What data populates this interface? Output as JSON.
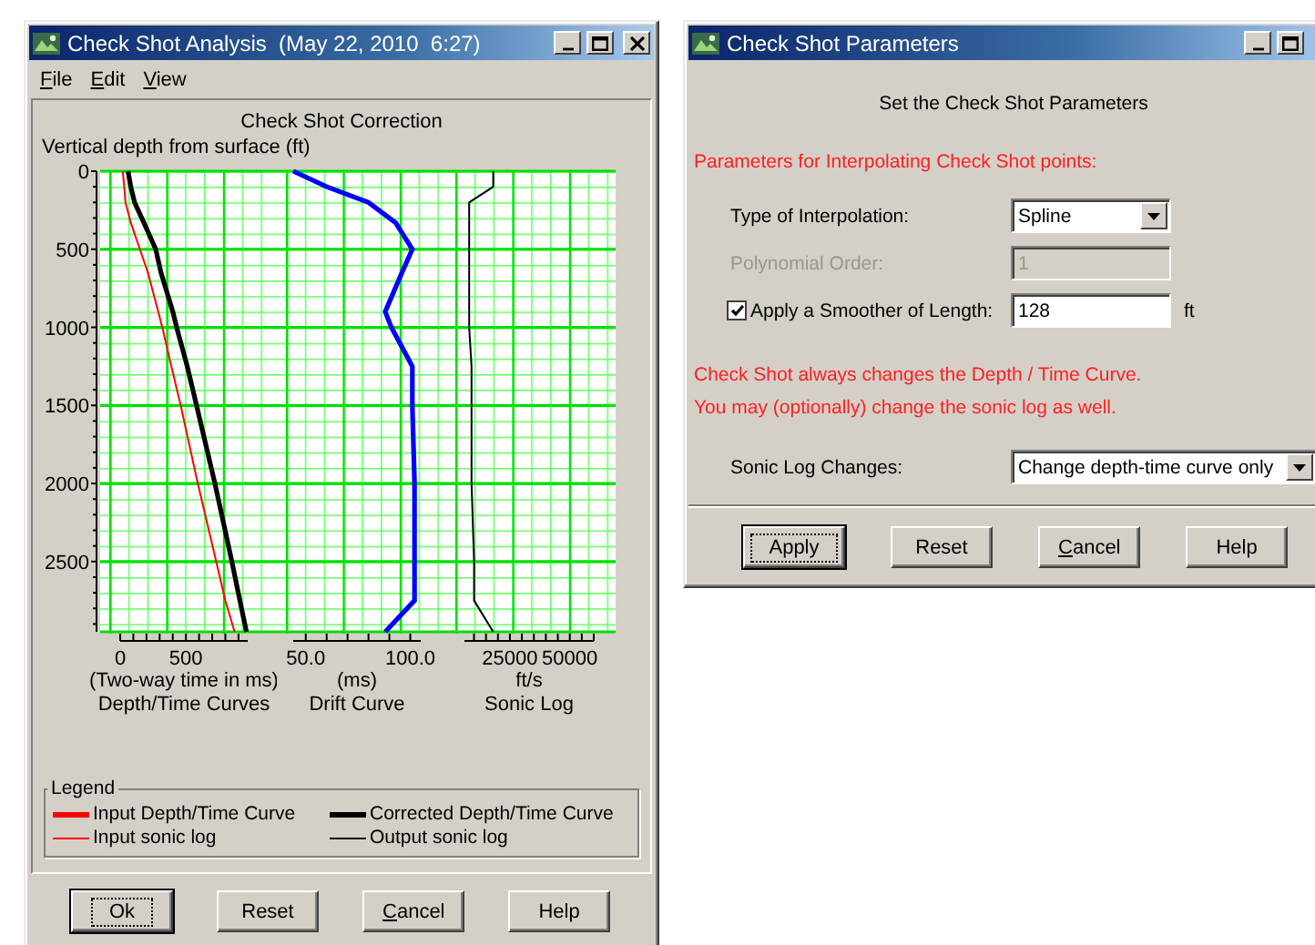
{
  "analysis_window": {
    "title": "Check Shot Analysis  (May 22, 2010  6:27)",
    "menu": [
      {
        "label": "File"
      },
      {
        "label": "Edit"
      },
      {
        "label": "View"
      }
    ],
    "chart_title": "Check Shot Correction",
    "charts": [
      {
        "chart_data": {
          "type": "line",
          "orientation": "horizontal",
          "title": "Depth/Time Curves",
          "xlabel": "(Two-way time in ms)",
          "ylabel": "Vertical depth from surface (ft)",
          "x": [
            0,
            100,
            200,
            330,
            500,
            650,
            900,
            1000,
            1250,
            1500,
            2000,
            2500,
            2750,
            2950
          ],
          "xlim": [
            0,
            970
          ],
          "ylim": [
            2950,
            0
          ],
          "grid": true,
          "xticks": [
            0,
            500
          ],
          "yticks": [
            0,
            500,
            1000,
            1500,
            2000,
            2500
          ],
          "series": [
            {
              "color": "#ff0000",
              "values": [
                20,
                30,
                40,
                80,
                150,
                210,
                290,
                320,
                390,
                460,
                590,
                730,
                800,
                870
              ]
            },
            {
              "color": "#000000",
              "values": [
                60,
                80,
                110,
                180,
                270,
                310,
                400,
                430,
                510,
                580,
                720,
                850,
                910,
                960
              ]
            }
          ]
        }
      },
      {
        "chart_data": {
          "type": "line",
          "orientation": "horizontal",
          "title": "Drift Curve",
          "xlabel": "(ms)",
          "x": [
            0,
            100,
            200,
            330,
            500,
            650,
            900,
            1000,
            1250,
            1500,
            2000,
            2500,
            2750,
            2950
          ],
          "xlim": [
            44,
            105
          ],
          "ylim": [
            2950,
            0
          ],
          "grid": true,
          "xticks": [
            {
              "value": 50,
              "label": "50.0"
            },
            {
              "value": 100,
              "label": "100.0"
            }
          ],
          "series": [
            {
              "color": "#0000ff",
              "values": [
                44,
                60,
                80,
                93,
                101,
                96,
                88,
                91,
                101,
                101,
                102,
                102,
                102,
                88
              ]
            }
          ]
        }
      },
      {
        "chart_data": {
          "type": "line",
          "orientation": "horizontal",
          "title": "Sonic Log",
          "xlabel": "ft/s",
          "x": [
            0,
            100,
            200,
            330,
            500,
            650,
            900,
            1000,
            1250,
            1500,
            2000,
            2500,
            2750,
            2950
          ],
          "xlim": [
            6000,
            60000
          ],
          "ylim": [
            2950,
            0
          ],
          "grid": true,
          "xticks": [
            25000,
            50000
          ],
          "series": [
            {
              "color": "#000000",
              "values": [
                18000,
                18000,
                8000,
                8000,
                8000,
                8000,
                8000,
                8000,
                9000,
                9000,
                9000,
                10000,
                10000,
                18000
              ]
            }
          ]
        }
      }
    ],
    "legend": {
      "title": "Legend",
      "items": [
        {
          "label": "Input Depth/Time Curve",
          "color": "#ff0000",
          "kind": "thick"
        },
        {
          "label": "Corrected Depth/Time Curve",
          "color": "#000000",
          "kind": "thick"
        },
        {
          "label": "Input sonic log",
          "color": "#ff0000",
          "kind": "thin"
        },
        {
          "label": "Output sonic log",
          "color": "#000000",
          "kind": "thin"
        }
      ]
    },
    "buttons": [
      {
        "label": "Ok",
        "default": true,
        "mnemonic": false
      },
      {
        "label": "Reset",
        "default": false,
        "mnemonic": false
      },
      {
        "label": "Cancel",
        "default": false,
        "mnemonic": true
      },
      {
        "label": "Help",
        "default": false,
        "mnemonic": false
      }
    ]
  },
  "parameters_window": {
    "title": "Check Shot Parameters",
    "heading": "Set the Check Shot Parameters",
    "section_label": "Parameters for Interpolating Check Shot points:",
    "fields": [
      {
        "kind": "select",
        "label": "Type of Interpolation:",
        "value": "Spline",
        "disabled": false
      },
      {
        "kind": "text",
        "label": "Polynomial Order:",
        "value": "1",
        "disabled": true
      },
      {
        "kind": "checkbox",
        "label": "Apply a Smoother of Length:",
        "checked": true,
        "value": "128",
        "unit": "ft",
        "disabled": false
      }
    ],
    "notes": [
      "Check Shot always changes the Depth / Time Curve.",
      "You may (optionally) change the sonic log as well."
    ],
    "sonic": {
      "label": "Sonic Log Changes:",
      "value": "Change depth-time curve only"
    },
    "buttons": [
      {
        "label": "Apply",
        "default": true,
        "mnemonic": false
      },
      {
        "label": "Reset",
        "default": false,
        "mnemonic": false
      },
      {
        "label": "Cancel",
        "default": false,
        "mnemonic": true
      },
      {
        "label": "Help",
        "default": false,
        "mnemonic": false
      }
    ]
  }
}
